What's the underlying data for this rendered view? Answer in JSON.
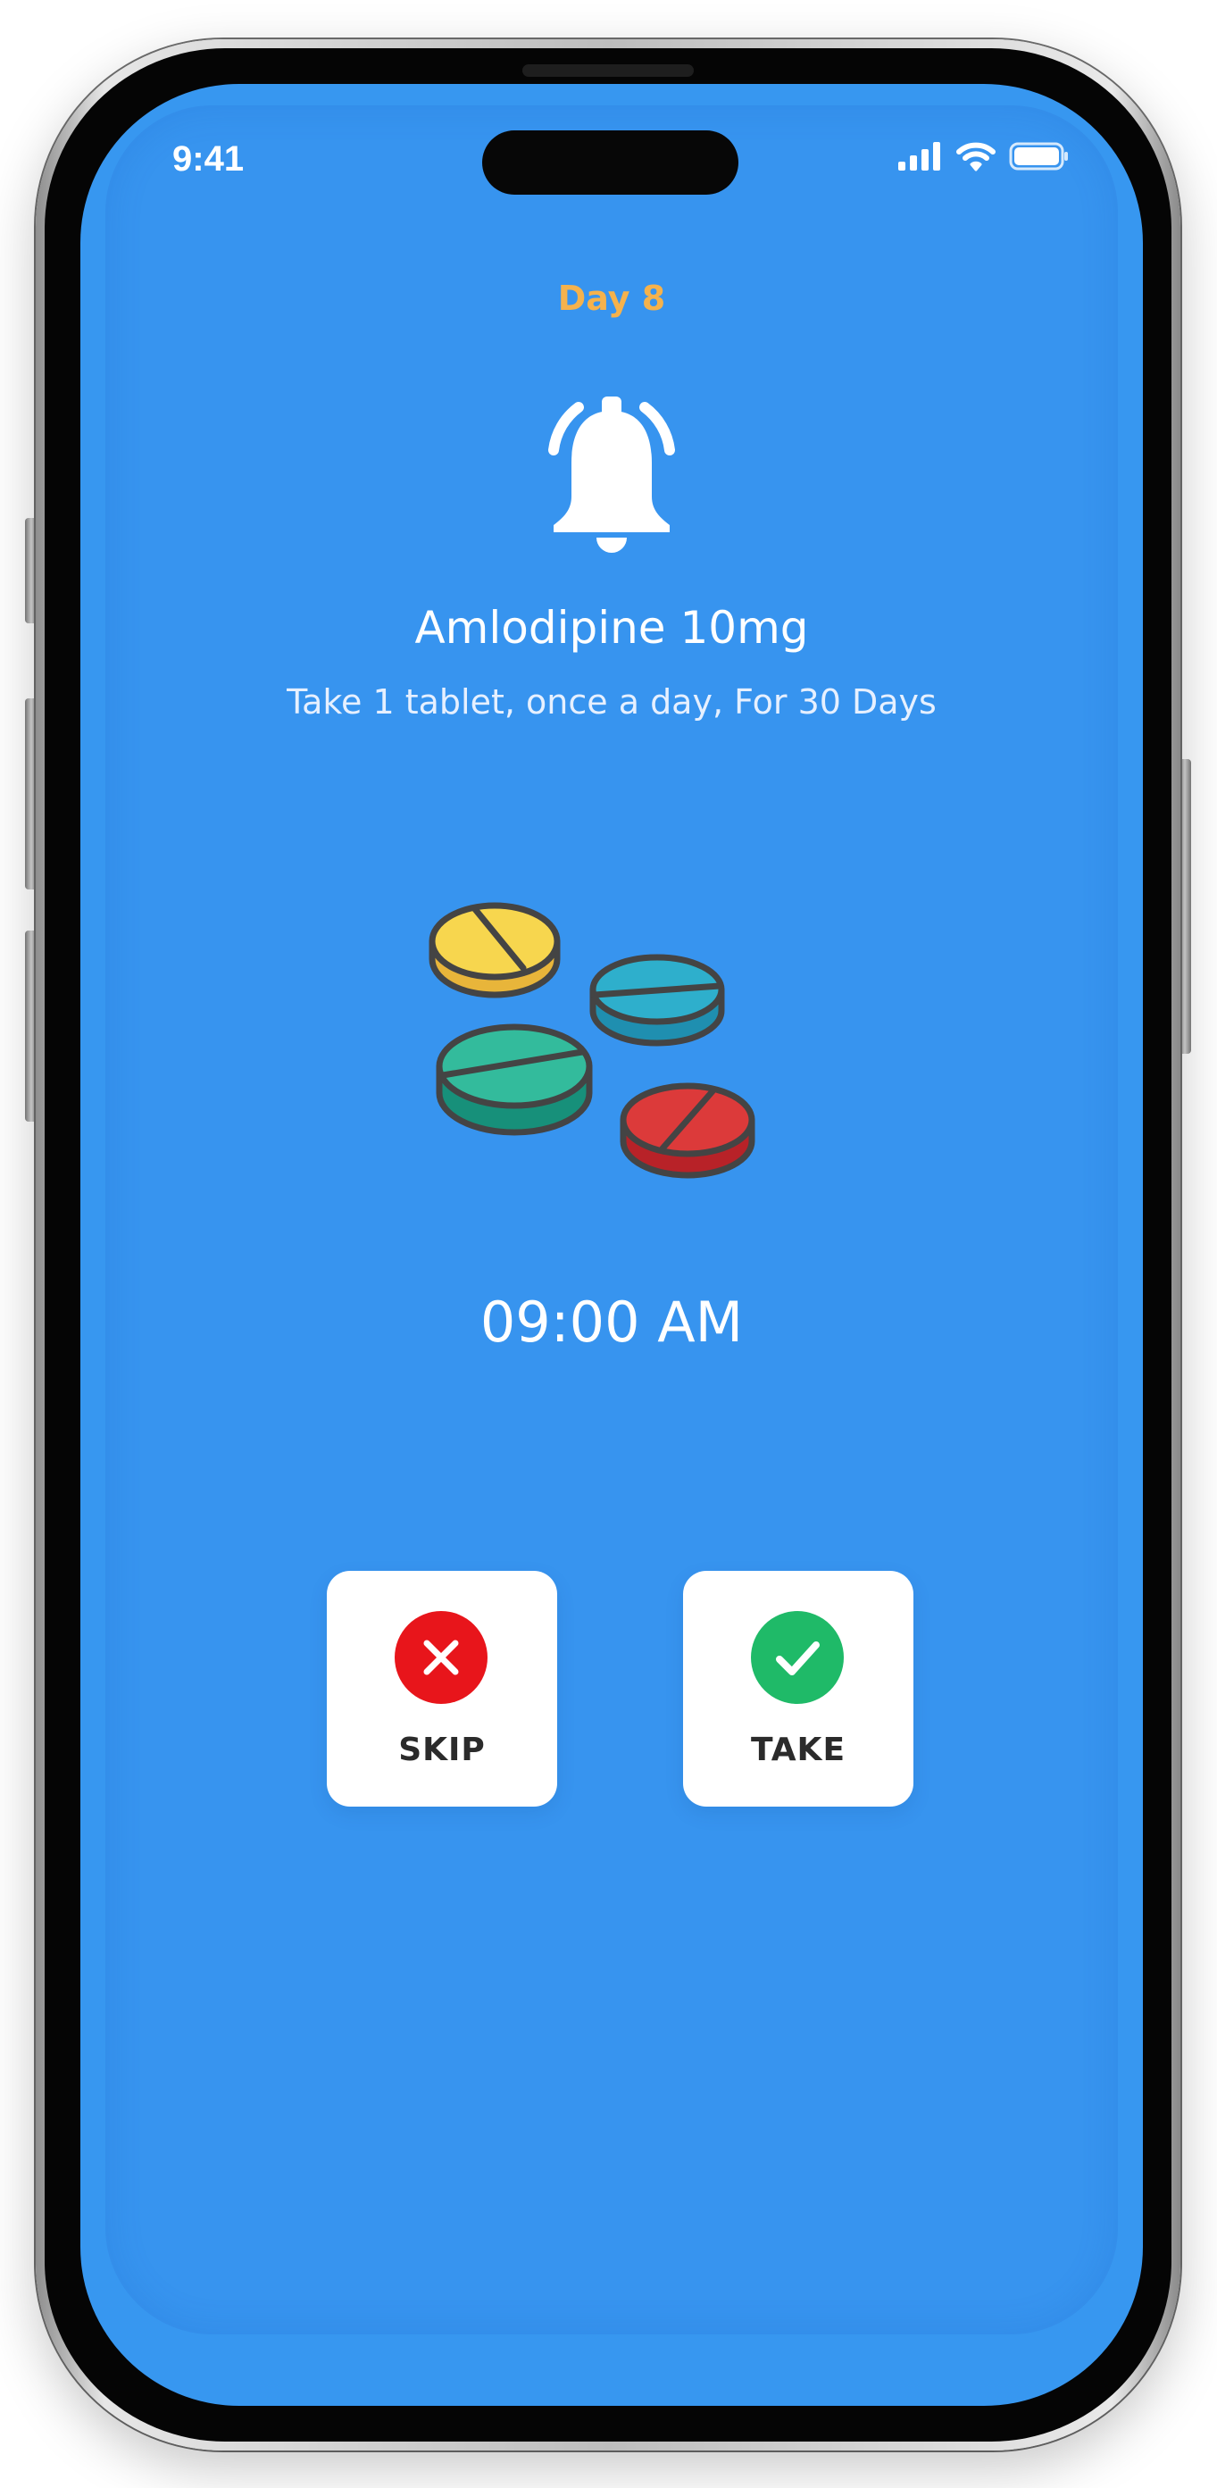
{
  "status_bar": {
    "time": "9:41",
    "icons": [
      "cellular-signal-icon",
      "wifi-icon",
      "battery-icon"
    ]
  },
  "reminder": {
    "day": "Day 8",
    "alert_icon": "bell-icon",
    "medication_name": "Amlodipine 10mg",
    "instructions": "Take 1 tablet, once a day, For 30 Days",
    "illustration": "pills-illustration",
    "time": "09:00 AM"
  },
  "actions": {
    "skip_label": "SKIP",
    "skip_icon": "x-circle-icon",
    "take_label": "TAKE",
    "take_icon": "check-circle-icon"
  },
  "colors": {
    "background": "#3797f0",
    "day_accent": "#f5b24c",
    "skip": "#e8151b",
    "take": "#1fba68",
    "text": "#ffffff"
  }
}
